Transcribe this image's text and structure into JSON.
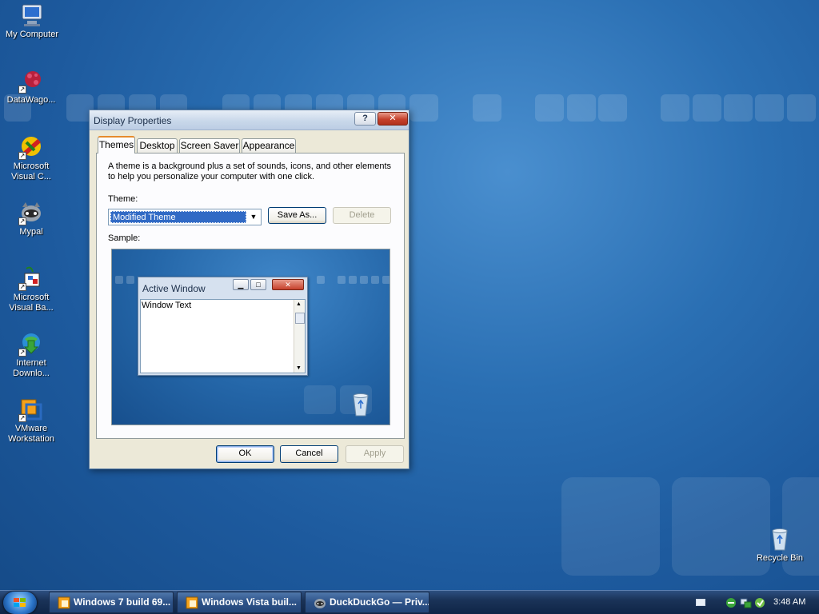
{
  "desktop": {
    "icons": [
      {
        "label": "My Computer",
        "icon": "my-computer-icon"
      },
      {
        "label": "DataWago...",
        "icon": "datawagon-icon"
      },
      {
        "label": "Microsoft Visual C...",
        "icon": "visual-c-icon"
      },
      {
        "label": "Mypal",
        "icon": "mypal-icon"
      },
      {
        "label": "Microsoft Visual Ba...",
        "icon": "visual-basic-icon"
      },
      {
        "label": "Internet Downlo...",
        "icon": "internet-download-icon"
      },
      {
        "label": "VMware Workstation",
        "icon": "vmware-icon"
      },
      {
        "label": "Recycle Bin",
        "icon": "recycle-bin-icon"
      }
    ]
  },
  "dialog": {
    "title": "Display Properties",
    "help_label": "?",
    "close_label": "✕",
    "tabs": [
      {
        "label": "Themes",
        "active": true
      },
      {
        "label": "Desktop"
      },
      {
        "label": "Screen Saver"
      },
      {
        "label": "Appearance"
      }
    ],
    "description": "A theme is a background plus a set of sounds, icons, and other elements to help you personalize your computer with one click.",
    "theme_label": "Theme:",
    "theme_value": "Modified Theme",
    "save_as_label": "Save As...",
    "delete_label": "Delete",
    "sample_label": "Sample:",
    "sample_window": {
      "title": "Active Window",
      "body_text": "Window Text"
    },
    "ok_label": "OK",
    "cancel_label": "Cancel",
    "apply_label": "Apply"
  },
  "taskbar": {
    "tasks": [
      {
        "label": "Windows 7 build 69..."
      },
      {
        "label": "Windows Vista buil..."
      },
      {
        "label": "DuckDuckGo — Priv..."
      }
    ],
    "clock": "3:48 AM"
  },
  "colors": {
    "selection": "#316ac5",
    "active_tab_accent": "#e68b2c",
    "close_button": "#c6412c"
  }
}
